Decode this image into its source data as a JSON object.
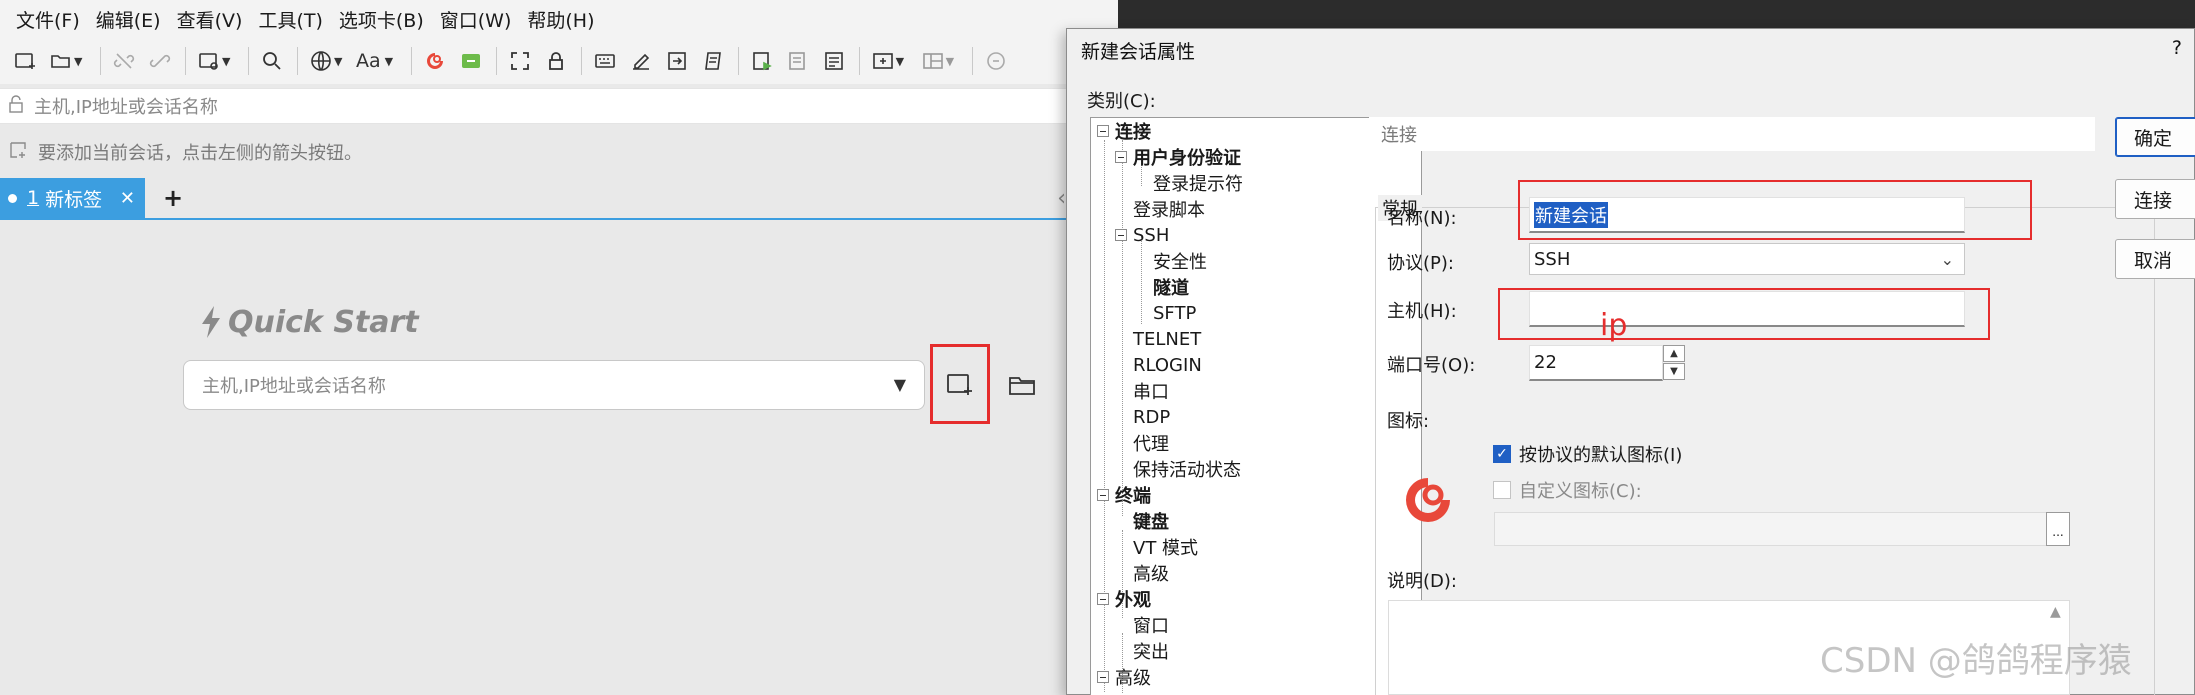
{
  "menu": [
    "文件(F)",
    "编辑(E)",
    "查看(V)",
    "工具(T)",
    "选项卡(B)",
    "窗口(W)",
    "帮助(H)"
  ],
  "toolbar": {
    "font_label": "Aa"
  },
  "address_placeholder": "主机,IP地址或会话名称",
  "hint_text": "要添加当前会话，点击左侧的箭头按钮。",
  "tab": {
    "number": "1",
    "label": "新标签",
    "close": "✕",
    "add": "+"
  },
  "tab_scroll": "‹",
  "quick_start": {
    "title": "Quick Start",
    "placeholder": "主机,IP地址或会话名称"
  },
  "dialog": {
    "title": "新建会话属性",
    "help": "?",
    "category_label": "类别(C):",
    "section_header": "连接",
    "general_legend": "常规",
    "name_label": "名称(N):",
    "name_value": "新建会话",
    "protocol_label": "协议(P):",
    "protocol_value": "SSH",
    "host_label": "主机(H):",
    "host_value": "",
    "annotation": "ip",
    "port_label": "端口号(O):",
    "port_value": "22",
    "icon_label": "图标:",
    "default_icon_label": "按协议的默认图标(I)",
    "default_icon_checked": true,
    "custom_icon_label": "自定义图标(C):",
    "custom_icon_checked": false,
    "browse_label": "...",
    "description_label": "说明(D):",
    "buttons": {
      "ok": "确定",
      "connect": "连接",
      "cancel": "取消"
    }
  },
  "tree": [
    {
      "label": "连接",
      "bold": true
    },
    {
      "label": "用户身份验证",
      "bold": true
    },
    {
      "label": "登录提示符",
      "bold": false
    },
    {
      "label": "登录脚本",
      "bold": false
    },
    {
      "label": "SSH",
      "bold": false
    },
    {
      "label": "安全性",
      "bold": false
    },
    {
      "label": "隧道",
      "bold": true
    },
    {
      "label": "SFTP",
      "bold": false
    },
    {
      "label": "TELNET",
      "bold": false
    },
    {
      "label": "RLOGIN",
      "bold": false
    },
    {
      "label": "串口",
      "bold": false
    },
    {
      "label": "RDP",
      "bold": false
    },
    {
      "label": "代理",
      "bold": false
    },
    {
      "label": "保持活动状态",
      "bold": false
    },
    {
      "label": "终端",
      "bold": true
    },
    {
      "label": "键盘",
      "bold": true
    },
    {
      "label": "VT 模式",
      "bold": false
    },
    {
      "label": "高级",
      "bold": false
    },
    {
      "label": "外观",
      "bold": true
    },
    {
      "label": "窗口",
      "bold": false
    },
    {
      "label": "突出",
      "bold": false
    },
    {
      "label": "高级",
      "bold": false
    }
  ],
  "watermark": "CSDN @鸽鸽程序猿",
  "colors": {
    "accent": "#3c9ee0",
    "annotation": "#e52d2d",
    "selection": "#1f5fc4",
    "xshell_logo": "#e8483a"
  }
}
